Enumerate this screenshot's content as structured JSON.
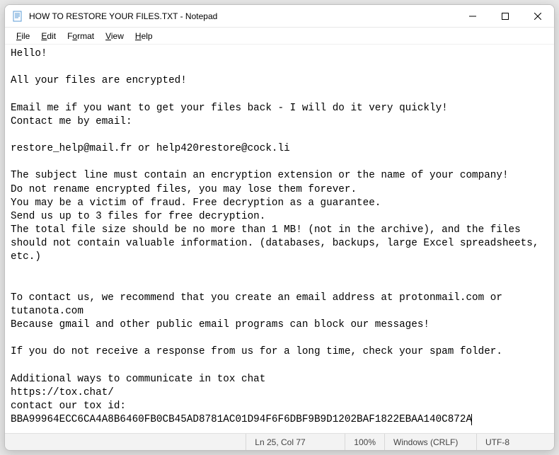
{
  "window": {
    "title": "HOW TO RESTORE YOUR FILES.TXT - Notepad",
    "app_name": "Notepad",
    "icon": "notepad-icon"
  },
  "menu": {
    "file": "File",
    "edit": "Edit",
    "format": "Format",
    "view": "View",
    "help": "Help"
  },
  "content": {
    "text": "Hello!\n\nAll your files are encrypted!\n\nEmail me if you want to get your files back - I will do it very quickly!\nContact me by email:\n\nrestore_help@mail.fr or help420restore@cock.li\n\nThe subject line must contain an encryption extension or the name of your company!\nDo not rename encrypted files, you may lose them forever.\nYou may be a victim of fraud. Free decryption as a guarantee.\nSend us up to 3 files for free decryption.\nThe total file size should be no more than 1 MB! (not in the archive), and the files should not contain valuable information. (databases, backups, large Excel spreadsheets, etc.)\n\n\nTo contact us, we recommend that you create an email address at protonmail.com or tutanota.com\nBecause gmail and other public email programs can block our messages!\n\nIf you do not receive a response from us for a long time, check your spam folder.\n\nAdditional ways to communicate in tox chat\nhttps://tox.chat/\ncontact our tox id:\nBBA99964ECC6CA4A8B6460FB0CB45AD8781AC01D94F6F6DBF9B9D1202BAF1822EBAA140C872A"
  },
  "status": {
    "position": "Ln 25, Col 77",
    "zoom": "100%",
    "line_endings": "Windows (CRLF)",
    "encoding": "UTF-8"
  }
}
